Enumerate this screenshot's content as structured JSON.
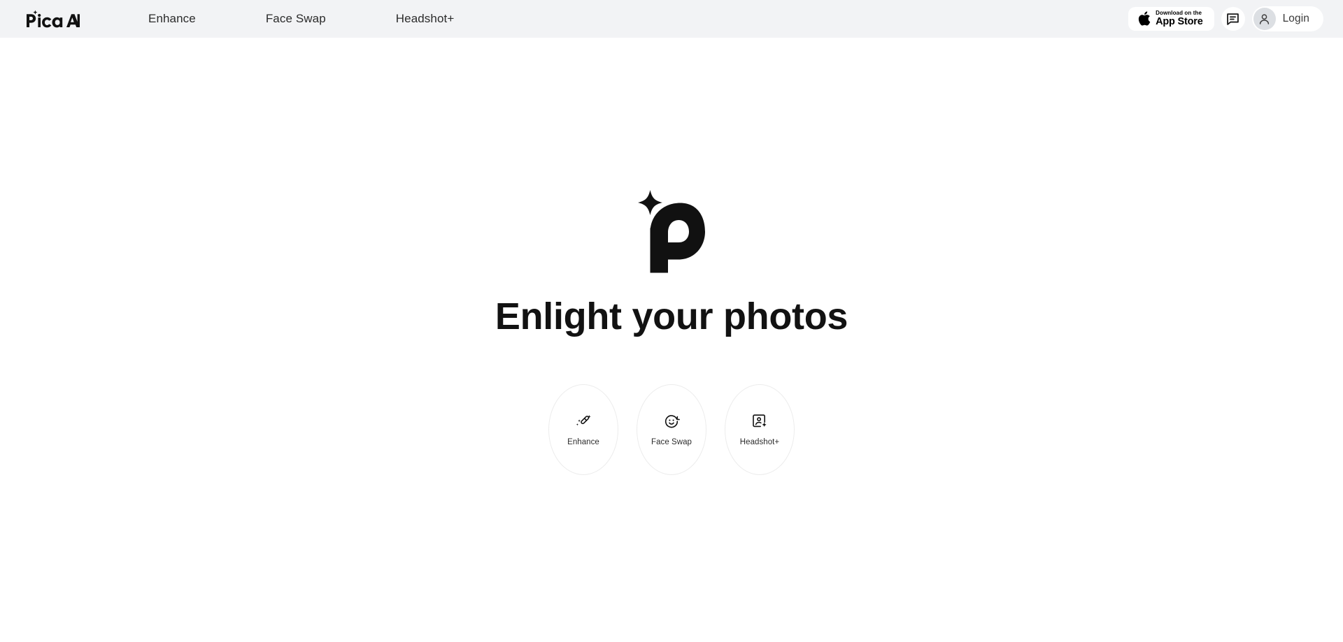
{
  "header": {
    "brand": {
      "name": "Pica AI",
      "icon": "pica-logo-wordmark"
    },
    "nav": [
      {
        "label": "Enhance"
      },
      {
        "label": "Face Swap"
      },
      {
        "label": "Headshot+"
      }
    ],
    "appstore": {
      "small_label": "Download on the",
      "big_label": "App Store",
      "icon": "apple-icon"
    },
    "chat": {
      "icon": "chat-bubble-icon"
    },
    "login": {
      "label": "Login",
      "icon": "user-avatar-icon"
    }
  },
  "hero": {
    "logo_icon": "pica-p-sparkle-logo",
    "title": "Enlight your photos",
    "features": [
      {
        "label": "Enhance",
        "icon": "magic-wand-sparkles-icon"
      },
      {
        "label": "Face Swap",
        "icon": "smiley-face-refresh-icon"
      },
      {
        "label": "Headshot+",
        "icon": "portrait-card-sparkle-icon"
      }
    ]
  },
  "colors": {
    "header_bg": "#f2f3f5",
    "page_bg": "#ffffff",
    "text": "#121212",
    "gradient_cyan": "#82fffa",
    "gradient_lavender": "#cec4f6",
    "gradient_pink": "#facde4",
    "gradient_peach": "#ffce90"
  }
}
